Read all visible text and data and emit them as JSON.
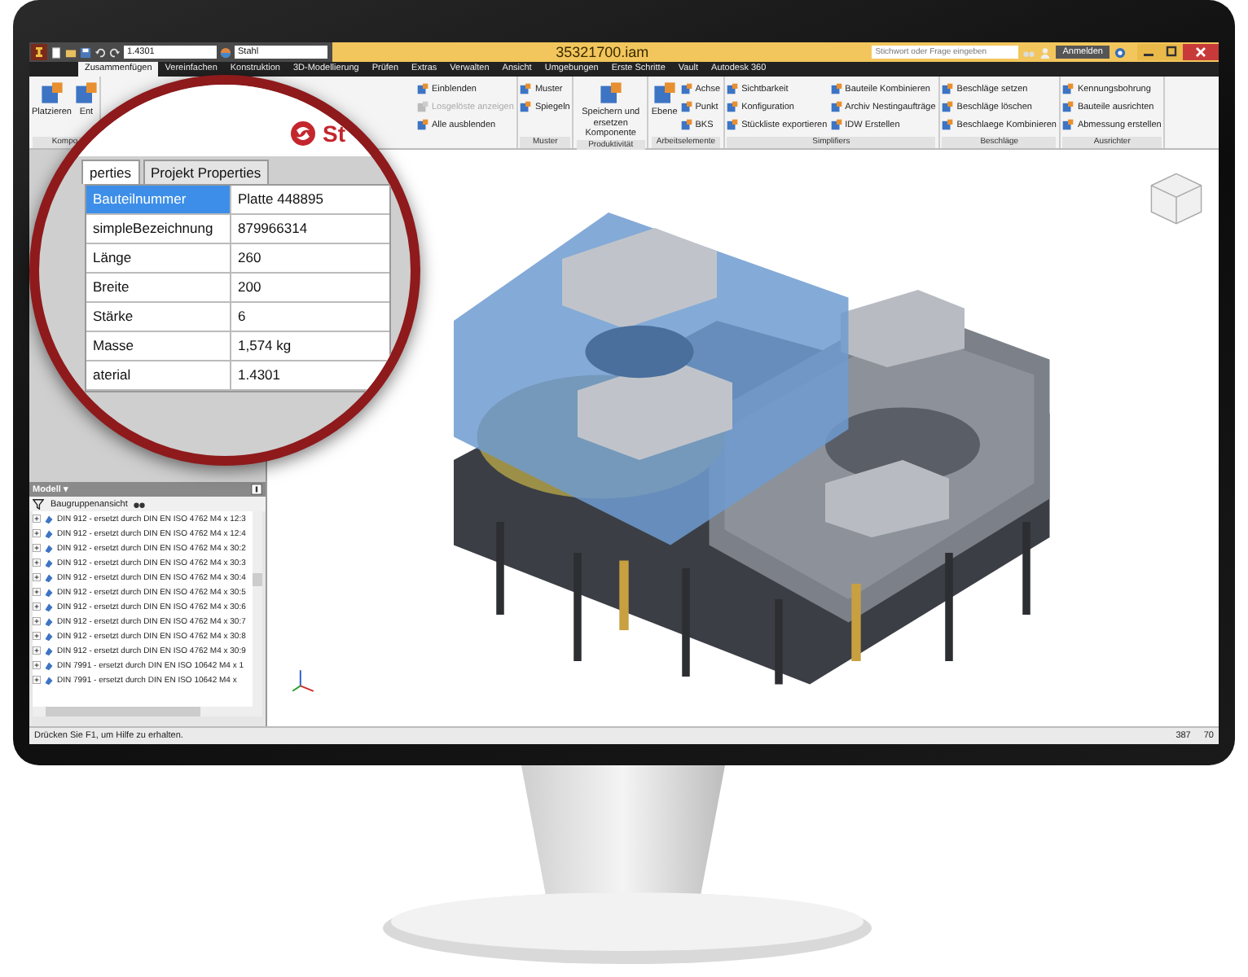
{
  "title_bar": {
    "material": "1.4301",
    "appearance": "Stahl",
    "title": "35321700.iam",
    "search": {
      "placeholder": "Stichwort oder Frage eingeben"
    },
    "sign_in": "Anmelden"
  },
  "ribbon_tabs": [
    {
      "label": "Zusammenfügen",
      "selected": true
    },
    {
      "label": "Vereinfachen",
      "selected": false
    },
    {
      "label": "Konstruktion",
      "selected": false
    },
    {
      "label": "3D-Modellierung",
      "selected": false
    },
    {
      "label": "Prüfen",
      "selected": false
    },
    {
      "label": "Extras",
      "selected": false
    },
    {
      "label": "Verwalten",
      "selected": false
    },
    {
      "label": "Ansicht",
      "selected": false
    },
    {
      "label": "Umgebungen",
      "selected": false
    },
    {
      "label": "Erste Schritte",
      "selected": false
    },
    {
      "label": "Vault",
      "selected": false
    },
    {
      "label": "Autodesk 360",
      "selected": false
    }
  ],
  "ribbon_groups": [
    {
      "label": "Kompo",
      "tools": [
        {
          "kind": "large",
          "label": "Platzieren",
          "disabled": false
        },
        {
          "kind": "large",
          "label": "Ent",
          "disabled": false
        }
      ]
    },
    {
      "tools": [
        {
          "kind": "small",
          "label": "Einblenden",
          "disabled": false
        },
        {
          "kind": "small",
          "label": "Losgelöste anzeigen",
          "disabled": true
        },
        {
          "kind": "small",
          "label": "Alle ausblenden",
          "disabled": false
        }
      ]
    },
    {
      "label": "Muster",
      "tools": [
        {
          "kind": "small",
          "label": "Muster",
          "disabled": false
        },
        {
          "kind": "small",
          "label": "Spiegeln",
          "disabled": false
        }
      ]
    },
    {
      "label": "Produktivität",
      "tools": [
        {
          "kind": "large",
          "label": "Speichern und ersetzen Komponente",
          "disabled": false
        }
      ]
    },
    {
      "label": "Arbeitselemente",
      "tools": [
        {
          "kind": "large",
          "label": "Ebene",
          "disabled": false
        },
        {
          "kind": "small",
          "label": "Achse",
          "disabled": false
        },
        {
          "kind": "small",
          "label": "Punkt",
          "disabled": false
        },
        {
          "kind": "small",
          "label": "BKS",
          "disabled": false
        }
      ]
    },
    {
      "label": "Simplifiers",
      "tools": [
        {
          "kind": "small",
          "label": "Sichtbarkeit",
          "disabled": false
        },
        {
          "kind": "small",
          "label": "Konfiguration",
          "disabled": false
        },
        {
          "kind": "small",
          "label": "Stückliste exportieren",
          "disabled": false
        },
        {
          "kind": "small",
          "label": "Bauteile Kombinieren",
          "disabled": false
        },
        {
          "kind": "small",
          "label": "Archiv Nestingaufträge",
          "disabled": false
        },
        {
          "kind": "small",
          "label": "IDW Erstellen",
          "disabled": false
        }
      ]
    },
    {
      "label": "Beschläge",
      "tools": [
        {
          "kind": "small",
          "label": "Beschläge setzen",
          "disabled": false
        },
        {
          "kind": "small",
          "label": "Beschläge löschen",
          "disabled": false
        },
        {
          "kind": "small",
          "label": "Beschlaege Kombinieren",
          "disabled": false
        }
      ]
    },
    {
      "label": "Ausrichter",
      "tools": [
        {
          "kind": "small",
          "label": "Kennungsbohrung",
          "disabled": false
        },
        {
          "kind": "small",
          "label": "Bauteile ausrichten",
          "disabled": false
        },
        {
          "kind": "small",
          "label": "Abmessung erstellen",
          "disabled": false
        }
      ]
    }
  ],
  "browser": {
    "title": "Modell ▾",
    "view": "Baugruppenansicht",
    "items": [
      "DIN 912 - ersetzt durch DIN EN ISO 4762 M4 x 12:3",
      "DIN 912 - ersetzt durch DIN EN ISO 4762 M4 x 12:4",
      "DIN 912 - ersetzt durch DIN EN ISO 4762 M4 x 30:2",
      "DIN 912 - ersetzt durch DIN EN ISO 4762 M4 x 30:3",
      "DIN 912 - ersetzt durch DIN EN ISO 4762 M4 x 30:4",
      "DIN 912 - ersetzt durch DIN EN ISO 4762 M4 x 30:5",
      "DIN 912 - ersetzt durch DIN EN ISO 4762 M4 x 30:6",
      "DIN 912 - ersetzt durch DIN EN ISO 4762 M4 x 30:7",
      "DIN 912 - ersetzt durch DIN EN ISO 4762 M4 x 30:8",
      "DIN 912 - ersetzt durch DIN EN ISO 4762 M4 x 30:9",
      "DIN 7991 - ersetzt durch DIN EN ISO 10642 M4 x 1",
      "DIN 7991 - ersetzt durch DIN EN ISO 10642 M4 x"
    ]
  },
  "status_bar": {
    "message": "Drücken Sie F1, um Hilfe zu erhalten.",
    "value_1": "387",
    "value_2": "70"
  },
  "magnifier": {
    "logo_text": "St",
    "tabs": [
      {
        "label": "perties",
        "selected": true
      },
      {
        "label": "Projekt Properties",
        "selected": false
      }
    ],
    "properties": [
      {
        "name": "Bauteilnummer",
        "value": "Platte 448895",
        "selected": true
      },
      {
        "name": "simpleBezeichnung",
        "value": "879966314",
        "selected": false
      },
      {
        "name": "Länge",
        "value": "260",
        "selected": false
      },
      {
        "name": "Breite",
        "value": "200",
        "selected": false
      },
      {
        "name": "Stärke",
        "value": "6",
        "selected": false
      },
      {
        "name": "Masse",
        "value": "1,574 kg",
        "selected": false
      },
      {
        "name": "aterial",
        "value": "1.4301",
        "selected": false
      }
    ]
  }
}
